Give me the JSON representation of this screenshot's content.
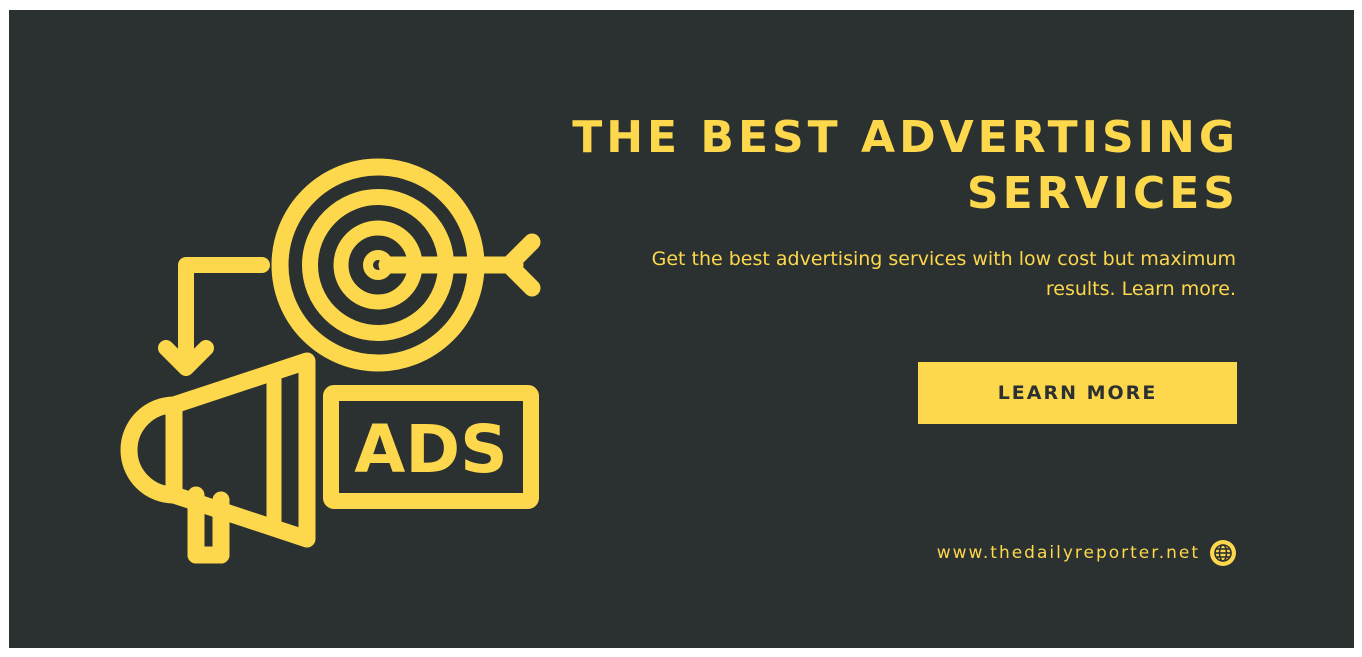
{
  "banner": {
    "headline": "THE BEST ADVERTISING SERVICES",
    "subtext": "Get the best advertising services with low cost but maximum results. Learn more.",
    "cta_label": "LEARN MORE",
    "website": "www.thedailyreporter.net",
    "ads_label": "ADS"
  },
  "icons": {
    "target": "target-icon",
    "megaphone": "megaphone-icon",
    "arrow": "curved-arrow-icon",
    "globe": "globe-icon"
  },
  "colors": {
    "background": "#2b3130",
    "accent": "#fdd84d"
  }
}
